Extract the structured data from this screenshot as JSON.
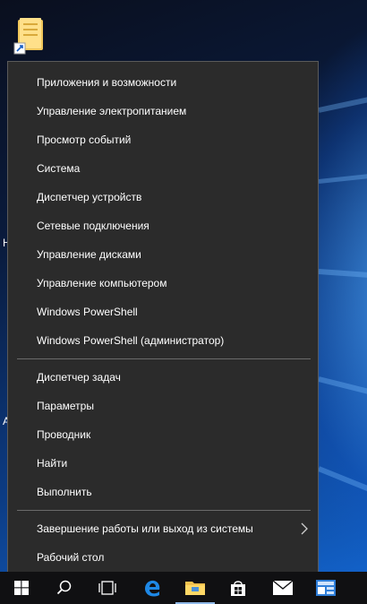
{
  "desktop": {
    "partial_chars": [
      "Н",
      "А"
    ],
    "icon": "folder-shortcut-icon"
  },
  "menu": {
    "group1": [
      {
        "label": "Приложения и возможности",
        "name": "menu-item-apps-features"
      },
      {
        "label": "Управление электропитанием",
        "name": "menu-item-power-options"
      },
      {
        "label": "Просмотр событий",
        "name": "menu-item-event-viewer"
      },
      {
        "label": "Система",
        "name": "menu-item-system"
      },
      {
        "label": "Диспетчер устройств",
        "name": "menu-item-device-manager"
      },
      {
        "label": "Сетевые подключения",
        "name": "menu-item-network-connections"
      },
      {
        "label": "Управление дисками",
        "name": "menu-item-disk-management"
      },
      {
        "label": "Управление компьютером",
        "name": "menu-item-computer-management"
      },
      {
        "label": "Windows PowerShell",
        "name": "menu-item-powershell"
      },
      {
        "label": "Windows PowerShell (администратор)",
        "name": "menu-item-powershell-admin"
      }
    ],
    "group2": [
      {
        "label": "Диспетчер задач",
        "name": "menu-item-task-manager"
      },
      {
        "label": "Параметры",
        "name": "menu-item-settings"
      },
      {
        "label": "Проводник",
        "name": "menu-item-file-explorer"
      },
      {
        "label": "Найти",
        "name": "menu-item-search"
      },
      {
        "label": "Выполнить",
        "name": "menu-item-run"
      }
    ],
    "group3": [
      {
        "label": "Завершение работы или выход из системы",
        "name": "menu-item-shutdown-signout",
        "has_submenu": true
      },
      {
        "label": "Рабочий стол",
        "name": "menu-item-desktop"
      }
    ]
  },
  "taskbar": {
    "buttons": [
      {
        "icon": "windows-start-icon"
      },
      {
        "icon": "search-icon"
      },
      {
        "icon": "task-view-icon"
      },
      {
        "icon": "edge-browser-icon"
      },
      {
        "icon": "file-explorer-icon"
      },
      {
        "icon": "store-icon"
      },
      {
        "icon": "mail-icon"
      },
      {
        "icon": "app-icon"
      }
    ]
  },
  "colors": {
    "menu_bg": "#2b2b2b",
    "menu_text": "#ffffff",
    "taskbar_bg": "#101012",
    "accent": "#1e88e5"
  }
}
